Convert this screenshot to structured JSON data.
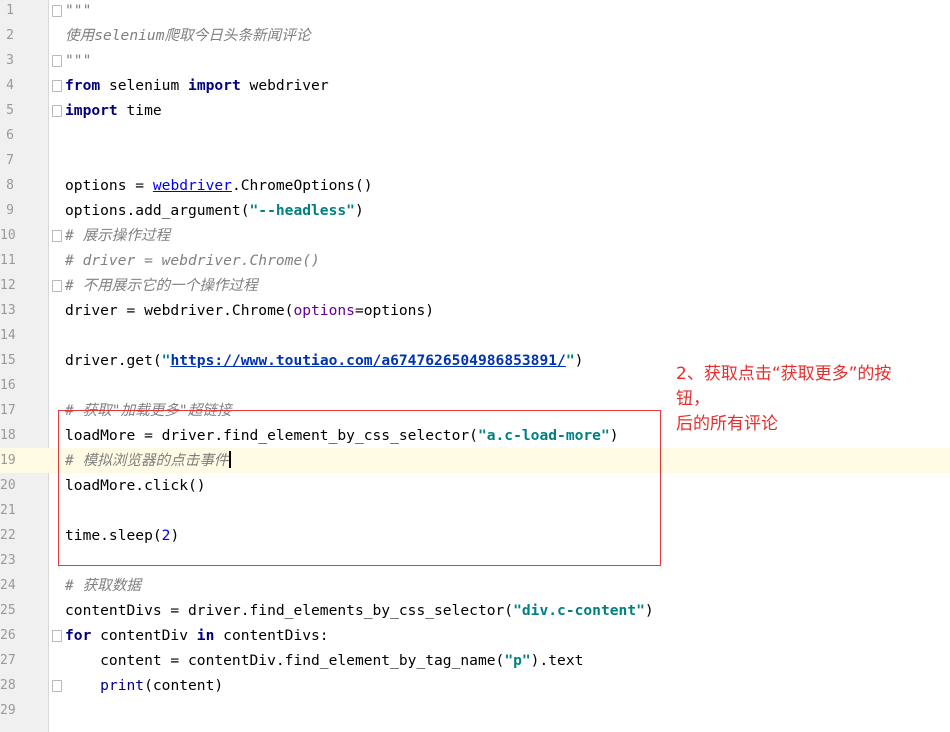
{
  "editor": {
    "lines": [
      {
        "n": "1",
        "fold": true,
        "tokens": [
          {
            "t": "\"\"\"",
            "c": "cm"
          }
        ]
      },
      {
        "n": "2",
        "fold": false,
        "tokens": [
          {
            "t": "使用selenium爬取今日头条新闻评论",
            "c": "cm"
          }
        ]
      },
      {
        "n": "3",
        "fold": true,
        "tokens": [
          {
            "t": "\"\"\"",
            "c": "cm"
          }
        ]
      },
      {
        "n": "4",
        "fold": true,
        "tokens": [
          {
            "t": "from",
            "c": "kw"
          },
          {
            "t": " selenium ",
            "c": ""
          },
          {
            "t": "import",
            "c": "kw"
          },
          {
            "t": " webdriver",
            "c": ""
          }
        ]
      },
      {
        "n": "5",
        "fold": true,
        "tokens": [
          {
            "t": "import",
            "c": "kw"
          },
          {
            "t": " time",
            "c": ""
          }
        ]
      },
      {
        "n": "6",
        "fold": false,
        "tokens": []
      },
      {
        "n": "7",
        "fold": false,
        "tokens": []
      },
      {
        "n": "8",
        "fold": false,
        "tokens": [
          {
            "t": "options = ",
            "c": ""
          },
          {
            "t": "webdriver",
            "c": "ref"
          },
          {
            "t": ".ChromeOptions()",
            "c": ""
          }
        ]
      },
      {
        "n": "9",
        "fold": false,
        "tokens": [
          {
            "t": "options.add_argument(",
            "c": ""
          },
          {
            "t": "\"--headless\"",
            "c": "st"
          },
          {
            "t": ")",
            "c": ""
          }
        ]
      },
      {
        "n": "10",
        "fold": true,
        "tokens": [
          {
            "t": "# 展示操作过程",
            "c": "cm"
          }
        ]
      },
      {
        "n": "11",
        "fold": false,
        "tokens": [
          {
            "t": "# driver = webdriver.Chrome()",
            "c": "cm"
          }
        ]
      },
      {
        "n": "12",
        "fold": true,
        "tokens": [
          {
            "t": "# 不用展示它的一个操作过程",
            "c": "cm"
          }
        ]
      },
      {
        "n": "13",
        "fold": false,
        "tokens": [
          {
            "t": "driver = webdriver.Chrome(",
            "c": ""
          },
          {
            "t": "options",
            "c": "kwarg"
          },
          {
            "t": "=options)",
            "c": ""
          }
        ]
      },
      {
        "n": "14",
        "fold": false,
        "tokens": []
      },
      {
        "n": "15",
        "fold": false,
        "tokens": [
          {
            "t": "driver.get(",
            "c": ""
          },
          {
            "t": "\"",
            "c": "st"
          },
          {
            "t": "https://www.toutiao.com/a6747626504986853891/",
            "c": "st lnk"
          },
          {
            "t": "\"",
            "c": "st"
          },
          {
            "t": ")",
            "c": ""
          }
        ]
      },
      {
        "n": "16",
        "fold": false,
        "tokens": []
      },
      {
        "n": "17",
        "fold": false,
        "tokens": [
          {
            "t": "# 获取\"加载更多\"超链接",
            "c": "cm"
          }
        ]
      },
      {
        "n": "18",
        "fold": false,
        "tokens": [
          {
            "t": "loadMore = driver.find_element_by_css_selector(",
            "c": ""
          },
          {
            "t": "\"a.c-load-more\"",
            "c": "st"
          },
          {
            "t": ")",
            "c": ""
          }
        ]
      },
      {
        "n": "19",
        "fold": false,
        "caret": true,
        "tokens": [
          {
            "t": "# 模拟浏览器的点击事件",
            "c": "cm"
          }
        ]
      },
      {
        "n": "20",
        "fold": false,
        "tokens": [
          {
            "t": "loadMore.click()",
            "c": ""
          }
        ]
      },
      {
        "n": "21",
        "fold": false,
        "tokens": []
      },
      {
        "n": "22",
        "fold": false,
        "tokens": [
          {
            "t": "time.sleep(",
            "c": ""
          },
          {
            "t": "2",
            "c": "num"
          },
          {
            "t": ")",
            "c": ""
          }
        ]
      },
      {
        "n": "23",
        "fold": false,
        "tokens": []
      },
      {
        "n": "24",
        "fold": false,
        "tokens": [
          {
            "t": "# 获取数据",
            "c": "cm"
          }
        ]
      },
      {
        "n": "25",
        "fold": false,
        "tokens": [
          {
            "t": "contentDivs = driver.find_elements_by_css_selector(",
            "c": ""
          },
          {
            "t": "\"div.c-content\"",
            "c": "st"
          },
          {
            "t": ")",
            "c": ""
          }
        ]
      },
      {
        "n": "26",
        "fold": true,
        "tokens": [
          {
            "t": "for",
            "c": "kw"
          },
          {
            "t": " contentDiv ",
            "c": ""
          },
          {
            "t": "in",
            "c": "kw"
          },
          {
            "t": " contentDivs:",
            "c": ""
          }
        ]
      },
      {
        "n": "27",
        "fold": false,
        "tokens": [
          {
            "t": "    content = contentDiv.find_element_by_tag_name(",
            "c": ""
          },
          {
            "t": "\"p\"",
            "c": "st"
          },
          {
            "t": ").text",
            "c": ""
          }
        ]
      },
      {
        "n": "28",
        "fold": true,
        "tokens": [
          {
            "t": "    ",
            "c": ""
          },
          {
            "t": "print",
            "c": "builtin"
          },
          {
            "t": "(content)",
            "c": ""
          }
        ]
      },
      {
        "n": "29",
        "fold": false,
        "tokens": []
      }
    ]
  },
  "annotation": {
    "line1": "2、获取点击“获取更多”的按",
    "line2": "钮，",
    "line3": "后的所有评论",
    "color": "#e62e2e"
  }
}
